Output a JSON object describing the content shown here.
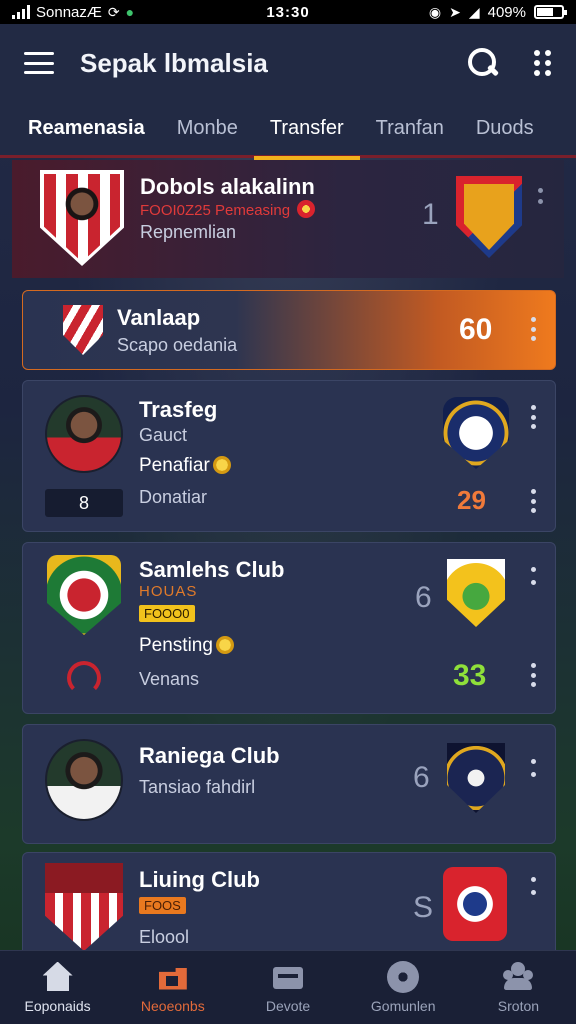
{
  "status_bar": {
    "carrier": "SonnazÆ",
    "time": "13:30",
    "battery": "409%"
  },
  "app_bar": {
    "title": "Sepak lbmalsia"
  },
  "tabs": [
    {
      "label": "Reamenasia"
    },
    {
      "label": "Monbe"
    },
    {
      "label": "Transfer"
    },
    {
      "label": "Tranfan"
    },
    {
      "label": "Duods"
    }
  ],
  "cards": {
    "hero": {
      "name": "Dobols alakalinn",
      "tag": "FOOI0Z25 Pemeasing",
      "position": "Repnemlian",
      "value": "1"
    },
    "highlight": {
      "name": "Vanlaap",
      "sub": "Scapo oedania",
      "value": "60"
    },
    "transfer": {
      "name": "Trasfeg",
      "sub": "Gauct",
      "status": "Penafiar",
      "rank": "8",
      "status2": "Donatiar",
      "value": "29"
    },
    "samehrs": {
      "name": "Samlehs Club",
      "label": "HOUAS",
      "tag": "FOOO0",
      "status": "Pensting",
      "status2": "Venans",
      "value_top": "6",
      "value": "33"
    },
    "raniega": {
      "name": "Raniega Club",
      "sub": "Tansiao fahdirl",
      "value": "6"
    },
    "living": {
      "name": "Liuing Club",
      "tag": "FOOS",
      "sub": "Eloool",
      "value": "S"
    }
  },
  "bottom_nav": [
    {
      "label": "Eoponaids"
    },
    {
      "label": "Neoeonbs"
    },
    {
      "label": "Devote"
    },
    {
      "label": "Gomunlen"
    },
    {
      "label": "Sroton"
    }
  ],
  "colors": {
    "accent": "#f2b21c",
    "highlight": "#ef7a1e",
    "nav_active": "#e26a3a"
  }
}
